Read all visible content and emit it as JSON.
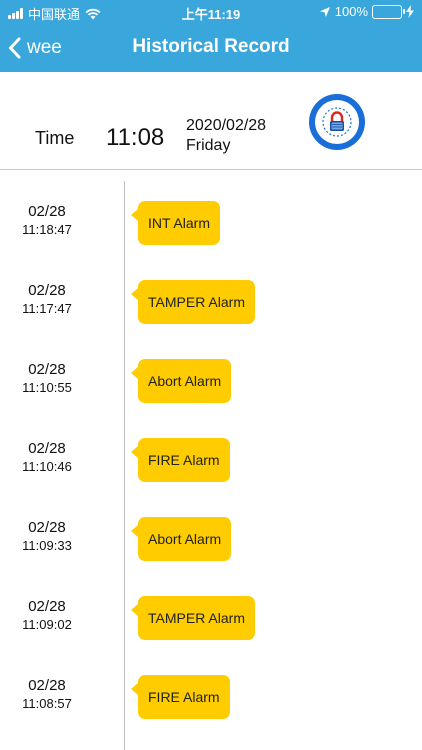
{
  "status_bar": {
    "carrier": "中国联通",
    "time": "上午11:19",
    "battery": "100%"
  },
  "nav": {
    "back_label": "wee",
    "title": "Historical Record"
  },
  "header": {
    "time_label": "Time",
    "time_value": "11:08",
    "date": "2020/02/28",
    "weekday": "Friday"
  },
  "records": [
    {
      "date": "02/28",
      "time": "11:18:47",
      "event": "INT Alarm"
    },
    {
      "date": "02/28",
      "time": "11:17:47",
      "event": "TAMPER Alarm"
    },
    {
      "date": "02/28",
      "time": "11:10:55",
      "event": "Abort Alarm"
    },
    {
      "date": "02/28",
      "time": "11:10:46",
      "event": "FIRE Alarm"
    },
    {
      "date": "02/28",
      "time": "11:09:33",
      "event": "Abort Alarm"
    },
    {
      "date": "02/28",
      "time": "11:09:02",
      "event": "TAMPER Alarm"
    },
    {
      "date": "02/28",
      "time": "11:08:57",
      "event": "FIRE Alarm"
    }
  ],
  "colors": {
    "nav_bg": "#3aa7dc",
    "bubble": "#ffcc00",
    "lock_ring": "#1a6ed8"
  }
}
